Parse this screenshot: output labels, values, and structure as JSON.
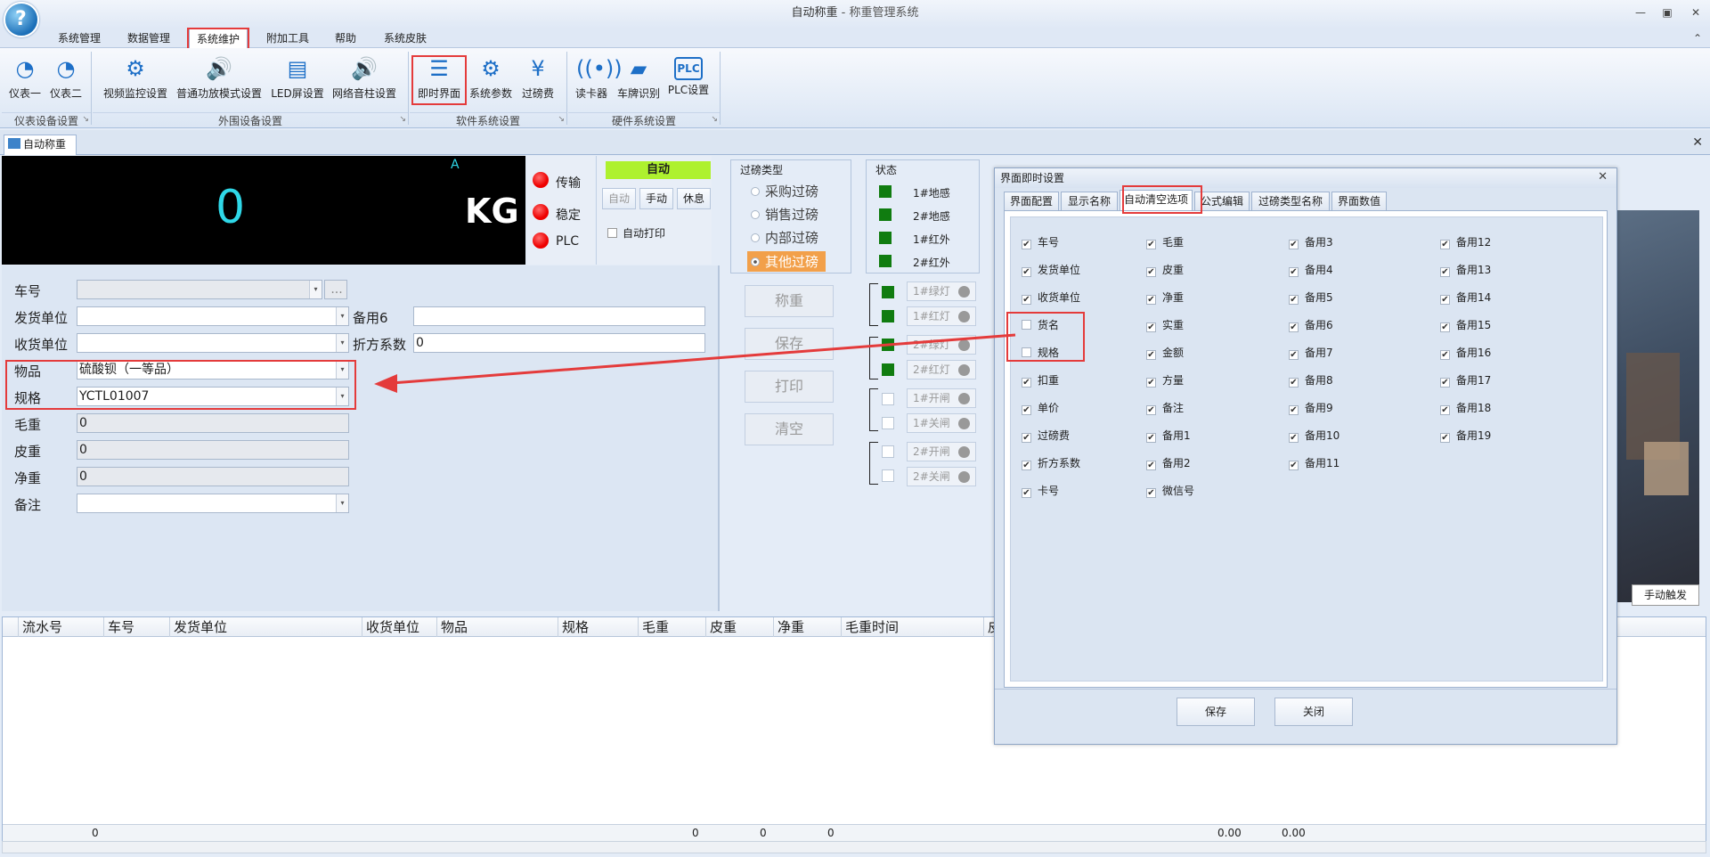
{
  "window": {
    "title": "自动称重",
    "subtitle": " - 称重管理系统",
    "min": "▭",
    "restore": "▣",
    "close": "✕",
    "collapse": "⌃"
  },
  "menu": [
    "系统管理",
    "数据管理",
    "系统维护",
    "附加工具",
    "帮助",
    "系统皮肤"
  ],
  "ribbon": {
    "buttons": [
      "仪表一",
      "仪表二",
      "视频监控设置",
      "普通功放模式设置",
      "LED屏设置",
      "网络音柱设置",
      "即时界面",
      "系统参数",
      "过磅费",
      "读卡器",
      "车牌识别",
      "PLC设置"
    ],
    "groups": [
      "仪表设备设置",
      "外围设备设置",
      "软件系统设置",
      "硬件系统设置"
    ],
    "plc_icon": "PLC"
  },
  "tab": {
    "label": "自动称重",
    "close": "✕"
  },
  "scale": {
    "value": "0",
    "unit": "KG",
    "channel": "A"
  },
  "leds": [
    "传输",
    "稳定",
    "PLC"
  ],
  "mode": {
    "badge": "自动",
    "buttons": [
      "自动",
      "手动",
      "休息"
    ],
    "auto_print": "自动打印"
  },
  "form": {
    "car_no": "车号",
    "sender": "发货单位",
    "receiver": "收货单位",
    "goods": "物品",
    "spec": "规格",
    "gross": "毛重",
    "tare": "皮重",
    "net": "净重",
    "remark": "备注",
    "spare6": "备用6",
    "discount": "折方系数",
    "goods_value": "硫酸钡（一等品）",
    "spec_value": "YCTL01007",
    "gross_value": "0",
    "tare_value": "0",
    "net_value": "0",
    "discount_value": "0",
    "browse": "..."
  },
  "wtype": {
    "title": "过磅类型",
    "options": [
      "采购过磅",
      "销售过磅",
      "内部过磅",
      "其他过磅"
    ],
    "selected": 3
  },
  "actions": [
    "称重",
    "保存",
    "打印",
    "清空"
  ],
  "status": {
    "title": "状态",
    "items": [
      "1#地感",
      "2#地感",
      "1#红外",
      "2#红外"
    ]
  },
  "lights": [
    "1#绿灯",
    "1#红灯",
    "2#绿灯",
    "2#红灯",
    "1#开闸",
    "1#关闸",
    "2#开闸",
    "2#关闸"
  ],
  "grid": {
    "columns": [
      "流水号",
      "车号",
      "发货单位",
      "收货单位",
      "物品",
      "规格",
      "毛重",
      "皮重",
      "净重",
      "毛重时间",
      "皮"
    ],
    "footer": [
      "0",
      "0",
      "0",
      "0",
      "0.00",
      "0.00"
    ]
  },
  "camera": {
    "trigger": "手动触发"
  },
  "dialog": {
    "title": "界面即时设置",
    "close": "✕",
    "tabs": [
      "界面配置",
      "显示名称",
      "自动清空选项",
      "公式编辑",
      "过磅类型名称",
      "界面数值"
    ],
    "active_tab": 2,
    "col1": [
      {
        "l": "车号",
        "c": true
      },
      {
        "l": "发货单位",
        "c": true
      },
      {
        "l": "收货单位",
        "c": true
      },
      {
        "l": "货名",
        "c": false
      },
      {
        "l": "规格",
        "c": false
      },
      {
        "l": "扣重",
        "c": true
      },
      {
        "l": "单价",
        "c": true
      },
      {
        "l": "过磅费",
        "c": true
      },
      {
        "l": "折方系数",
        "c": true
      },
      {
        "l": "卡号",
        "c": true
      }
    ],
    "col2": [
      {
        "l": "毛重",
        "c": true
      },
      {
        "l": "皮重",
        "c": true
      },
      {
        "l": "净重",
        "c": true
      },
      {
        "l": "实重",
        "c": true
      },
      {
        "l": "金额",
        "c": true
      },
      {
        "l": "方量",
        "c": true
      },
      {
        "l": "备注",
        "c": true
      },
      {
        "l": "备用1",
        "c": true
      },
      {
        "l": "备用2",
        "c": true
      },
      {
        "l": "微信号",
        "c": true
      }
    ],
    "col3": [
      {
        "l": "备用3",
        "c": true
      },
      {
        "l": "备用4",
        "c": true
      },
      {
        "l": "备用5",
        "c": true
      },
      {
        "l": "备用6",
        "c": true
      },
      {
        "l": "备用7",
        "c": true
      },
      {
        "l": "备用8",
        "c": true
      },
      {
        "l": "备用9",
        "c": true
      },
      {
        "l": "备用10",
        "c": true
      },
      {
        "l": "备用11",
        "c": true
      }
    ],
    "col4": [
      {
        "l": "备用12",
        "c": true
      },
      {
        "l": "备用13",
        "c": true
      },
      {
        "l": "备用14",
        "c": true
      },
      {
        "l": "备用15",
        "c": true
      },
      {
        "l": "备用16",
        "c": true
      },
      {
        "l": "备用17",
        "c": true
      },
      {
        "l": "备用18",
        "c": true
      },
      {
        "l": "备用19",
        "c": true
      }
    ],
    "save": "保存",
    "close_btn": "关闭"
  },
  "colors": {
    "accent": "#e43b3b",
    "auto": "#aef12e",
    "selected": "#f2a04a",
    "ok": "#107c10",
    "digits": "#2fd8e8"
  }
}
